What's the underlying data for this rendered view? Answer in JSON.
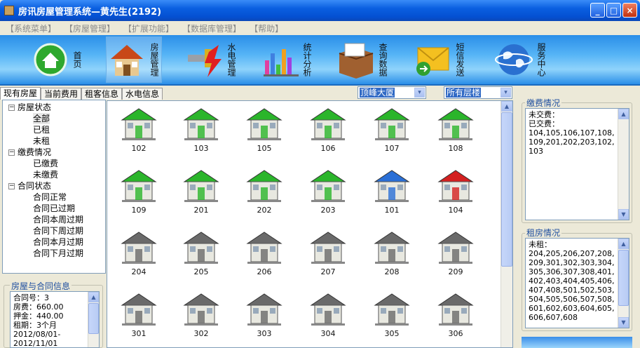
{
  "window": {
    "title": "房讯房屋管理系统—黄先生(2192)",
    "minimize": "_",
    "maximize": "□",
    "close": "×"
  },
  "menu": [
    "【系统菜单】",
    "【房屋管理】",
    "【扩展功能】",
    "【数据库管理】",
    "【帮助】"
  ],
  "toolbar": [
    {
      "label": "首页",
      "icon": "home-icon"
    },
    {
      "label": "房屋管理",
      "icon": "house-icon"
    },
    {
      "label": "水电管理",
      "icon": "utility-icon"
    },
    {
      "label": "统计分析",
      "icon": "chart-icon"
    },
    {
      "label": "查询数据",
      "icon": "query-icon"
    },
    {
      "label": "短信发送",
      "icon": "sms-icon"
    },
    {
      "label": "服务中心",
      "icon": "service-icon"
    }
  ],
  "tabs": [
    "现有房屋",
    "当前费用",
    "租客信息",
    "水电信息"
  ],
  "tree": {
    "house_status": "房屋状态",
    "all": "全部",
    "rented": "已租",
    "unrented": "未租",
    "payment": "缴费情况",
    "paid": "已缴费",
    "unpaid": "未缴费",
    "contract": "合同状态",
    "normal": "合同正常",
    "expired": "合同已过期",
    "this_week": "合同本周过期",
    "next_week": "合同下周过期",
    "this_month": "合同本月过期",
    "next_month": "合同下月过期"
  },
  "contract_info": {
    "title": "房屋与合同信息",
    "lines": [
      "合同号：3",
      "房费：660.00",
      "押金：440.00",
      "租期：3个月",
      "2012/08/01-",
      "2012/11/01"
    ]
  },
  "filters": {
    "building": "顶峰大厦",
    "floor": "所有层楼",
    "dropdown_arrow": "▾"
  },
  "houses": [
    {
      "num": "102",
      "color": "green"
    },
    {
      "num": "103",
      "color": "green"
    },
    {
      "num": "105",
      "color": "green"
    },
    {
      "num": "106",
      "color": "green"
    },
    {
      "num": "107",
      "color": "green"
    },
    {
      "num": "108",
      "color": "green"
    },
    {
      "num": "109",
      "color": "green"
    },
    {
      "num": "201",
      "color": "green"
    },
    {
      "num": "202",
      "color": "green"
    },
    {
      "num": "203",
      "color": "green"
    },
    {
      "num": "101",
      "color": "blue"
    },
    {
      "num": "104",
      "color": "red"
    },
    {
      "num": "204",
      "color": "gray"
    },
    {
      "num": "205",
      "color": "gray"
    },
    {
      "num": "206",
      "color": "gray"
    },
    {
      "num": "207",
      "color": "gray"
    },
    {
      "num": "208",
      "color": "gray"
    },
    {
      "num": "209",
      "color": "gray"
    },
    {
      "num": "301",
      "color": "gray"
    },
    {
      "num": "302",
      "color": "gray"
    },
    {
      "num": "303",
      "color": "gray"
    },
    {
      "num": "304",
      "color": "gray"
    },
    {
      "num": "305",
      "color": "gray"
    },
    {
      "num": "306",
      "color": "gray"
    }
  ],
  "payment_status": {
    "title": "缴费情况",
    "unpaid_label": "未交费：",
    "paid_label": "已交费：",
    "paid_list": "104,105,106,107,108,109,201,202,203,102,103"
  },
  "rental_status": {
    "title": "租房情况",
    "unrented_label": "未租：",
    "unrented_list": "204,205,206,207,208,209,301,302,303,304,305,306,307,308,401,402,403,404,405,406,407,408,501,502,503,504,505,506,507,508,601,602,603,604,605,606,607,608"
  },
  "scroll": {
    "up": "▲",
    "down": "▼"
  },
  "tree_glyphs": {
    "expanded": "−"
  },
  "colors": {
    "green": "#2bb52b",
    "blue": "#2a6fd6",
    "red": "#d42020",
    "gray": "#6a6a6a",
    "title_bar": "#0a5fe0"
  }
}
